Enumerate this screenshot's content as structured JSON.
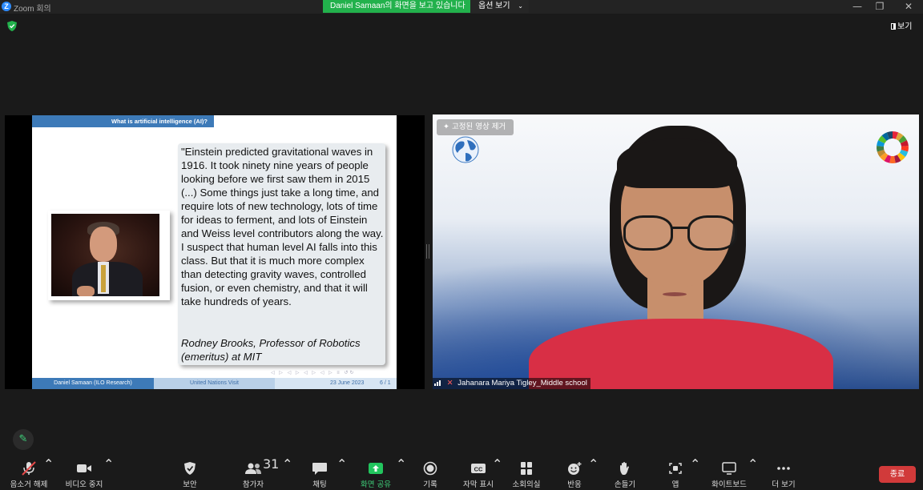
{
  "window": {
    "logo": "Z",
    "title": "Zoom 회의",
    "minimize_icon": "—",
    "restore_icon": "❐",
    "close_icon": "✕"
  },
  "share_banner": {
    "text": "Daniel  Samaan의 화면을 보고 있습니다",
    "view_options_label": "옵션 보기",
    "caret": "⌄"
  },
  "view_button": {
    "label": "보기"
  },
  "slide": {
    "header": "What is artificial intelligence (AI)?",
    "quote": "\"Einstein predicted gravitational waves in 1916. It took ninety nine years of people looking before we first saw them in 2015 (...) Some things just take a long time, and require lots of new technology, lots of time for ideas to ferment, and lots of Einstein and Weiss level contributors along the way. I suspect that human level AI falls into this class. But that it is much more complex than detecting gravity waves, controlled fusion, or even chemistry, and that it will take hundreds of years.",
    "author": "Rodney Brooks, Professor of Robotics (emeritus) at MIT",
    "nav_icons": "◁ ▷ ◁ ▷ ◁ ▷ ◁ ▷ ≡ ↺↻",
    "footer": {
      "left": "Daniel Samaan  (ILO Research)",
      "middle": "United Nations Visit",
      "date": "23 June 2023",
      "page": "6 / 1"
    }
  },
  "video": {
    "unpin_label": "고정된 영상 제거",
    "participant_name": "Jahanara Mariya Tigley_Middle school",
    "mic_off_icon": "✕"
  },
  "edit_icon": "✎",
  "toolbar": {
    "items": [
      {
        "label": "음소거 해제",
        "icon": "mic-off"
      },
      {
        "label": "비디오 중지",
        "icon": "video-camera"
      },
      {
        "label": "보안",
        "icon": "shield"
      },
      {
        "label": "참가자",
        "icon": "participants",
        "count": "31"
      },
      {
        "label": "채팅",
        "icon": "chat-bubble"
      },
      {
        "label": "화면 공유",
        "icon": "share-arrow"
      },
      {
        "label": "기록",
        "icon": "record"
      },
      {
        "label": "자막 표시",
        "icon": "cc",
        "badge": "CC"
      },
      {
        "label": "소회의실",
        "icon": "breakout-grid"
      },
      {
        "label": "반응",
        "icon": "smiley"
      },
      {
        "label": "손들기",
        "icon": "raise-hand"
      },
      {
        "label": "앱",
        "icon": "apps"
      },
      {
        "label": "화이트보드",
        "icon": "whiteboard"
      },
      {
        "label": "더 보기",
        "icon": "more-dots"
      }
    ],
    "caret": "⌃",
    "end_label": "종료"
  },
  "colors": {
    "share_green": "#22b14c",
    "slide_blue": "#3d7ab8",
    "end_red": "#d13a3a",
    "share_icon_green": "#22c55e"
  }
}
